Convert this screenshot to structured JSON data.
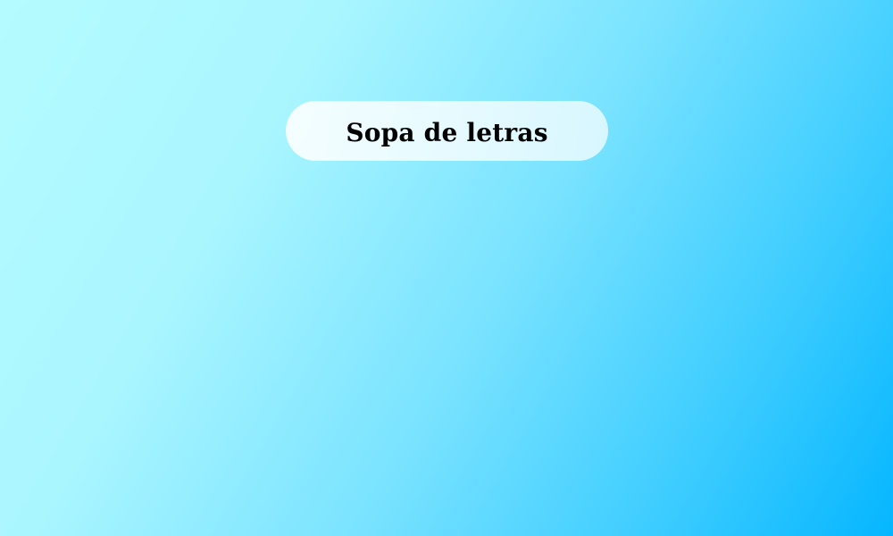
{
  "game": {
    "title": "Sopa de letras"
  },
  "colors": {
    "background_start": "#b4fbff",
    "background_end": "#05b6ff",
    "title_pill": "#f2fcff",
    "title_text": "#000000"
  }
}
